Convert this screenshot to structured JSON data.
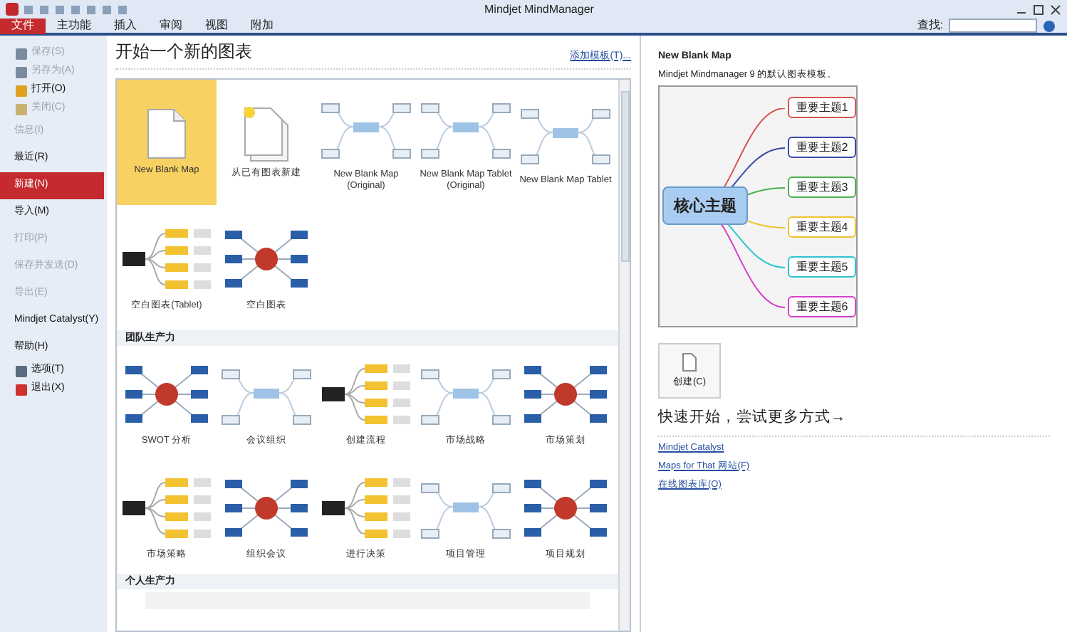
{
  "window": {
    "title": "Mindjet MindManager"
  },
  "ribbon": {
    "tabs": [
      {
        "label": "文件",
        "selected": true
      },
      {
        "label": "主功能",
        "selected": false
      },
      {
        "label": "插入",
        "selected": false
      },
      {
        "label": "审阅",
        "selected": false
      },
      {
        "label": "视图",
        "selected": false
      },
      {
        "label": "附加",
        "selected": false
      }
    ],
    "search_label": "查找:"
  },
  "sidebar": {
    "items": [
      {
        "label": "保存(S)",
        "kind": "icon",
        "disabled": true,
        "selected": false
      },
      {
        "label": "另存为(A)",
        "kind": "icon",
        "disabled": true,
        "selected": false
      },
      {
        "label": "打开(O)",
        "kind": "icon",
        "disabled": false,
        "selected": false
      },
      {
        "label": "关闭(C)",
        "kind": "icon",
        "disabled": true,
        "selected": false
      },
      {
        "label": "信息(I)",
        "kind": "text",
        "disabled": true,
        "selected": false
      },
      {
        "label": "最近(R)",
        "kind": "text",
        "disabled": false,
        "selected": false
      },
      {
        "label": "新建(N)",
        "kind": "text",
        "disabled": false,
        "selected": true
      },
      {
        "label": "导入(M)",
        "kind": "text",
        "disabled": false,
        "selected": false
      },
      {
        "label": "打印(P)",
        "kind": "text",
        "disabled": true,
        "selected": false
      },
      {
        "label": "保存并发送(D)",
        "kind": "text",
        "disabled": true,
        "selected": false
      },
      {
        "label": "导出(E)",
        "kind": "text",
        "disabled": true,
        "selected": false
      },
      {
        "label": "Mindjet Catalyst(Y)",
        "kind": "text",
        "disabled": false,
        "selected": false
      },
      {
        "label": "帮助(H)",
        "kind": "text",
        "disabled": false,
        "selected": false
      },
      {
        "label": "选项(T)",
        "kind": "icon",
        "disabled": false,
        "selected": false
      },
      {
        "label": "退出(X)",
        "kind": "icon",
        "disabled": false,
        "selected": false
      }
    ]
  },
  "gallery": {
    "title": "开始一个新的图表",
    "add_link": "添加模板(T)...",
    "sections": [
      {
        "items": [
          {
            "label": "New Blank Map",
            "kind": "blank",
            "selected": true
          },
          {
            "label": "从已有图表新建",
            "kind": "existing",
            "selected": false
          },
          {
            "label": "New Blank Map (Original)",
            "kind": "map",
            "selected": false
          },
          {
            "label": "New Blank Map Tablet (Original)",
            "kind": "map",
            "selected": false
          },
          {
            "label": "New Blank Map Tablet",
            "kind": "map",
            "selected": false
          },
          {
            "label": "空白图表(Tablet)",
            "kind": "tree",
            "selected": false
          },
          {
            "label": "空白图表",
            "kind": "radial",
            "selected": false
          }
        ]
      },
      {
        "heading": "团队生产力",
        "items": [
          {
            "label": "SWOT 分析",
            "kind": "radial",
            "selected": false
          },
          {
            "label": "会议组织",
            "kind": "map",
            "selected": false
          },
          {
            "label": "创建流程",
            "kind": "tree",
            "selected": false
          },
          {
            "label": "市场战略",
            "kind": "map",
            "selected": false
          },
          {
            "label": "市场策划",
            "kind": "radial",
            "selected": false
          },
          {
            "label": "市场策略",
            "kind": "tree",
            "selected": false
          },
          {
            "label": "组织会议",
            "kind": "radial",
            "selected": false
          },
          {
            "label": "进行决策",
            "kind": "tree",
            "selected": false
          },
          {
            "label": "项目管理",
            "kind": "map",
            "selected": false
          },
          {
            "label": "项目规划",
            "kind": "radial",
            "selected": false
          }
        ]
      },
      {
        "heading": "个人生产力"
      }
    ]
  },
  "detail": {
    "title": "New Blank Map",
    "description": "Mindjet Mindmanager 9 的默认图表模板。",
    "preview": {
      "center": "核心主题",
      "topics": [
        {
          "label": "重要主题1",
          "color": "#d9534f"
        },
        {
          "label": "重要主题2",
          "color": "#3b4aa8"
        },
        {
          "label": "重要主题3",
          "color": "#4caf50"
        },
        {
          "label": "重要主题4",
          "color": "#f2c230"
        },
        {
          "label": "重要主题5",
          "color": "#2ec4d0"
        },
        {
          "label": "重要主题6",
          "color": "#d63fc8"
        }
      ]
    },
    "create_button": "创建(C)",
    "quick_start": "快速开始，尝试更多方式→",
    "links": [
      "Mindjet Catalyst",
      "Maps for That 网站(F)",
      "在线图表库(O)"
    ]
  }
}
